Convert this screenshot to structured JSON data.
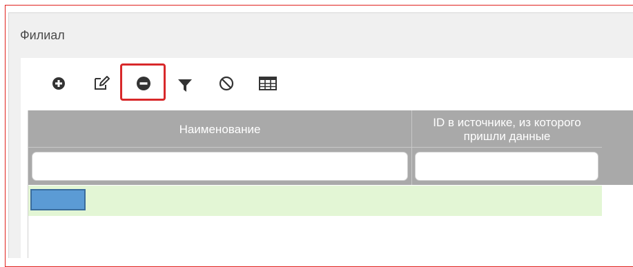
{
  "panel": {
    "title": "Филиал"
  },
  "toolbar": {
    "buttons": [
      {
        "icon": "plus-circle-icon",
        "name": "add"
      },
      {
        "icon": "edit-icon",
        "name": "edit"
      },
      {
        "icon": "minus-circle-icon",
        "name": "delete",
        "highlighted": true
      },
      {
        "icon": "filter-icon",
        "name": "filter"
      },
      {
        "icon": "ban-icon",
        "name": "clear-filter"
      },
      {
        "icon": "table-icon",
        "name": "columns"
      }
    ]
  },
  "grid": {
    "columns": [
      {
        "header": "Наименование"
      },
      {
        "header_line1": "ID в источнике, из которого",
        "header_line2": "пришли данные"
      }
    ],
    "filters": [
      {
        "value": "",
        "placeholder": ""
      },
      {
        "value": "",
        "placeholder": ""
      }
    ],
    "rows": [
      {
        "name": "",
        "source_id": "",
        "selected": true
      }
    ]
  },
  "colors": {
    "highlight": "#d8282a",
    "header_bg": "#a9a9a9",
    "selected_row": "#e3f6d5",
    "selected_cell": "#5b9bd5",
    "panel_bg": "#f0f0f0",
    "outline": "#e0201c"
  }
}
